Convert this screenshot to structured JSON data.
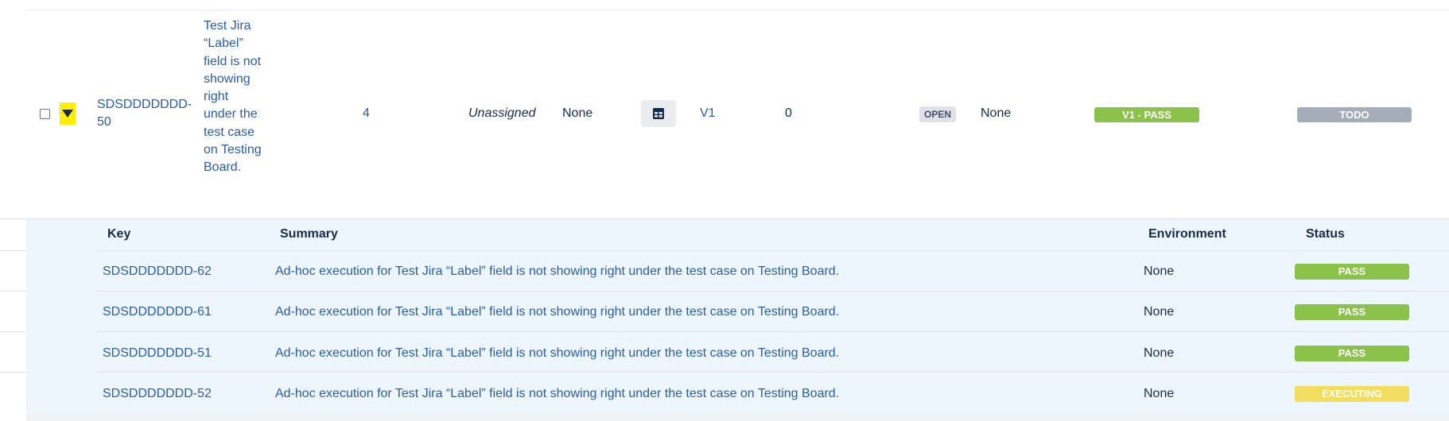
{
  "main_row": {
    "key": "SDSDDDDDDD-50",
    "summary": "Test Jira “Label” field is not showing right under the test case on Testing Board.",
    "count": "4",
    "assignee": "Unassigned",
    "field_none_1": "None",
    "icon": "table-view-icon",
    "version": "V1",
    "zero": "0",
    "status_lozenge": "OPEN",
    "field_none_2": "None",
    "execution_status": "V1 - PASS",
    "execution_status_color": "#8bc34a",
    "workflow_status": "TODO",
    "workflow_status_color": "#a5adba"
  },
  "sub_table": {
    "headers": {
      "key": "Key",
      "summary": "Summary",
      "environment": "Environment",
      "status": "Status"
    },
    "rows": [
      {
        "key": "SDSDDDDDDD-62",
        "summary": "Ad-hoc execution for Test Jira “Label” field is not showing right under the test case on Testing Board.",
        "environment": "None",
        "status": "PASS",
        "status_color": "#8bc34a"
      },
      {
        "key": "SDSDDDDDDD-61",
        "summary": "Ad-hoc execution for Test Jira “Label” field is not showing right under the test case on Testing Board.",
        "environment": "None",
        "status": "PASS",
        "status_color": "#8bc34a"
      },
      {
        "key": "SDSDDDDDDD-51",
        "summary": "Ad-hoc execution for Test Jira “Label” field is not showing right under the test case on Testing Board.",
        "environment": "None",
        "status": "PASS",
        "status_color": "#8bc34a"
      },
      {
        "key": "SDSDDDDDDD-52",
        "summary": "Ad-hoc execution for Test Jira “Label” field is not showing right under the test case on Testing Board.",
        "environment": "None",
        "status": "EXECUTING",
        "status_color": "#f2dd5e"
      }
    ]
  }
}
